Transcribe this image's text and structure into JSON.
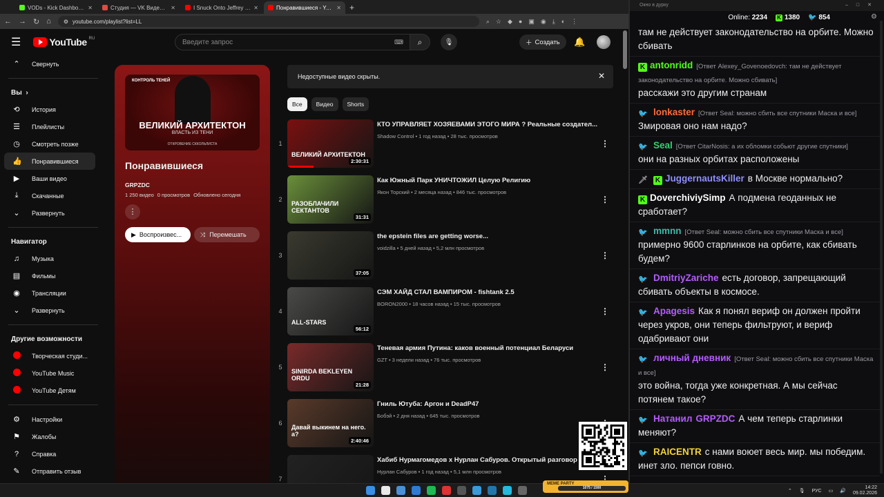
{
  "browser": {
    "tabs": [
      {
        "title": "VODs - Kick Dashboard",
        "color": "#53fc18"
      },
      {
        "title": "Студия — VK Видео Live",
        "color": "#e64646"
      },
      {
        "title": "I Snuck Onto Jeffrey Epstein's Is",
        "color": "#ff0000"
      },
      {
        "title": "Понравившиеся - YouTube",
        "color": "#ff0000"
      }
    ],
    "url": "youtube.com/playlist?list=LL",
    "new_tab": "+",
    "window_controls": [
      "–",
      "□",
      "✕"
    ]
  },
  "yt": {
    "logo": "YouTube",
    "country": "RU",
    "search_placeholder": "Введите запрос",
    "create_label": "Создать"
  },
  "sidebar": {
    "collapse": "Свернуть",
    "you": "Вы",
    "you_items": [
      "История",
      "Плейлисты",
      "Смотреть позже",
      "Понравившиеся",
      "Ваши видео",
      "Скачанные",
      "Развернуть"
    ],
    "nav_head": "Навигатор",
    "nav_items": [
      "Музыка",
      "Фильмы",
      "Трансляции",
      "Развернуть"
    ],
    "more_head": "Другие возможности",
    "more_items": [
      "Творческая студи...",
      "YouTube Music",
      "YouTube Детям"
    ],
    "bottom_items": [
      "Настройки",
      "Жалобы",
      "Справка",
      "Отправить отзыв"
    ]
  },
  "playlist": {
    "thumb_tag": "КОНТРОЛЬ ТЕНЕЙ",
    "thumb_title": "ВЕЛИКИЙ АРХИТЕКТОН",
    "thumb_sub": "ВЛАСТЬ ИЗ ТЕНИ",
    "thumb_small": "ОТКРОВЕНИЕ СККОЛЬЛИСТА",
    "title": "Понравившиеся",
    "owner": "GRPZDC",
    "count": "1 250 видео",
    "views": "0 просмотров",
    "updated": "Обновлено сегодня",
    "play_label": "Воспроизвес...",
    "shuffle_label": "Перемешать"
  },
  "notice": "Недоступные видео скрыты.",
  "chips": [
    "Все",
    "Видео",
    "Shorts"
  ],
  "videos": [
    {
      "index": "1",
      "title": "КТО УПРАВЛЯЕТ ХОЗЯЕВАМИ ЭТОГО МИРА ? Реальные создател...",
      "channel": "Shadow Control",
      "ago": "1 год назад",
      "views": "28 тыс. просмотров",
      "duration": "2:30:31",
      "thumb_text": "ВЕЛИКИЙ АРХИТЕКТОН",
      "bg": "#7a1010",
      "progress": 0.3
    },
    {
      "index": "2",
      "title": "Как Южный Парк УНИЧТОЖИЛ Целую Религию",
      "channel": "Якон Торский",
      "ago": "2 месяца назад",
      "views": "846 тыс. просмотров",
      "duration": "31:31",
      "thumb_text": "РАЗОБЛАЧИЛИ СЕКТАНТОВ",
      "bg": "#6a8f3a",
      "progress": 0.0
    },
    {
      "index": "3",
      "title": "the epstein files are getting worse...",
      "channel": "voidzilla",
      "ago": "5 дней назад",
      "views": "5,2 млн просмотров",
      "duration": "37:05",
      "thumb_text": "",
      "bg": "#3a3a30",
      "progress": 0.0
    },
    {
      "index": "4",
      "title": "СЭМ ХАЙД СТАЛ ВАМПИРОМ - fishtank 2.5",
      "channel": "BORON2000",
      "ago": "18 часов назад",
      "views": "15 тыс. просмотров",
      "duration": "56:12",
      "thumb_text": "ALL-STARS",
      "bg": "#4a4a48",
      "progress": 0.0
    },
    {
      "index": "5",
      "title": "Теневая армия Путина: каков военный потенциал Беларуси",
      "channel": "GZT",
      "ago": "3 недели назад",
      "views": "76 тыс. просмотров",
      "duration": "21:28",
      "thumb_text": "SINIRDA BEKLEYEN ORDU",
      "bg": "#7a2a2a",
      "progress": 0.0
    },
    {
      "index": "6",
      "title": "Гниль Ютуба: Аргон и DeadP47",
      "channel": "Бобэй",
      "ago": "2 дня назад",
      "views": "645 тыс. просмотров",
      "duration": "2:40:46",
      "thumb_text": "Давай выкинем на него. а?",
      "bg": "#5a3a2a",
      "progress": 0.0
    },
    {
      "index": "7",
      "title": "Хабиб Нурмагомедов х Нурлан Сабуров. Открытый разговор",
      "channel": "Нурлан Сабуров",
      "ago": "1 год назад",
      "views": "5,1 млн просмотров",
      "duration": "",
      "thumb_text": "",
      "bg": "#222",
      "progress": 0.0
    }
  ],
  "chat": {
    "window_title": "Окно в дурку",
    "online_label": "Online:",
    "online": "2234",
    "kick_count": "1380",
    "other_count": "854",
    "messages": [
      {
        "user": "",
        "color": "#efeff1",
        "badge": "",
        "reply": "",
        "text": "там не действует законодательство на орбите. Можно сбивать"
      },
      {
        "user": "antonridd",
        "color": "#53fc18",
        "badge": "k",
        "reply": "[Ответ Alexey_Govenoedovch: там не действует законодательство на орбите. Можно сбивать]",
        "text": "расскажи это другим странам"
      },
      {
        "user": "lonkaster",
        "color": "#ff6b3d",
        "badge": "bird",
        "reply": "[Ответ Seal: можно сбить все спутники Маска и все]",
        "text": "Змировая оно нам надо?"
      },
      {
        "user": "Seal",
        "color": "#35d26b",
        "badge": "bird",
        "reply": "[Ответ CitarNosis: а их обломки собьют другие спутники]",
        "text": "они на разных орбитах расположены"
      },
      {
        "user": "JuggernautsKiller",
        "color": "#8f8fff",
        "badge": "sword",
        "reply": "",
        "text": "в Москве нормально?"
      },
      {
        "user": "DoverchiviySimp",
        "color": "#ffffff",
        "badge": "k",
        "reply": "",
        "text": "А подмена геоданных не сработает?"
      },
      {
        "user": "mmnn",
        "color": "#3fb8a6",
        "badge": "bird",
        "reply": "[Ответ Seal: можно сбить все спутники Маска и все]",
        "text": "примерно 9600 старлинков на орбите, как сбивать будем?"
      },
      {
        "user": "DmitriyZariche",
        "color": "#b55cff",
        "badge": "bird",
        "reply": "",
        "text": "есть договор, запрещающий сбивать объекты в космосе."
      },
      {
        "user": "Apagesis",
        "color": "#b55cff",
        "badge": "bird",
        "reply": "",
        "text": "Как я понял вериф он должен пройти через укров, они теперь фильтруют, и вериф одабривают они"
      },
      {
        "user": "личный дневник",
        "color": "#b55cff",
        "badge": "bird",
        "reply": "[Ответ Seal: можно сбить все спутники Маска и все]",
        "text": "это война, тогда уже конкретная. А мы сейчас потянем такое?"
      },
      {
        "user": "Натанил",
        "color": "#b55cff",
        "badge": "bird",
        "reply": "",
        "mention": "GRPZDC",
        "text": "А чем теперь старлинки меняют?"
      },
      {
        "user": "RAICENTR",
        "color": "#f2d339",
        "badge": "bird",
        "reply": "",
        "text": "с нами воюет весь мир. мы победим. инет зло. пепси говно."
      }
    ]
  },
  "taskbar": {
    "lang": "РУС",
    "time": "14:22",
    "date": "09.02.2026",
    "meme_label": "MEME PARTY",
    "meme_progress": "1075 / 1500"
  }
}
